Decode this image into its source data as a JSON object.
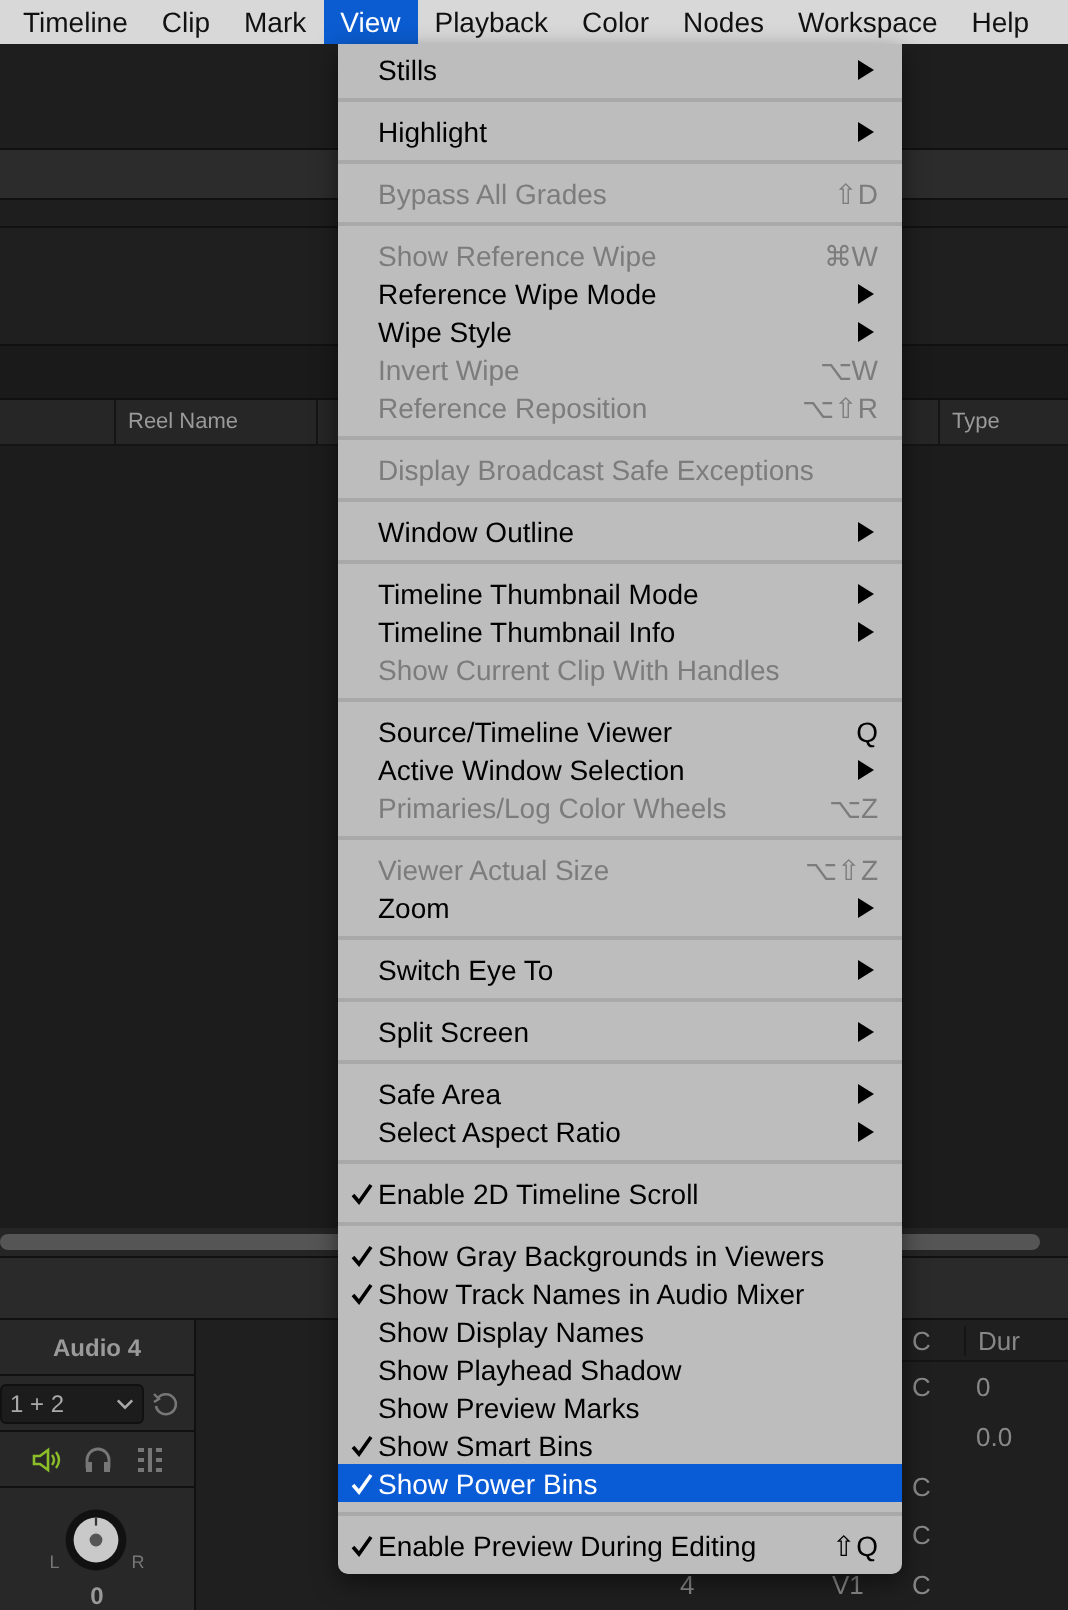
{
  "menu_bar": [
    {
      "label": "Timeline",
      "selected": false
    },
    {
      "label": "Clip",
      "selected": false
    },
    {
      "label": "Mark",
      "selected": false
    },
    {
      "label": "View",
      "selected": true
    },
    {
      "label": "Playback",
      "selected": false
    },
    {
      "label": "Color",
      "selected": false
    },
    {
      "label": "Nodes",
      "selected": false
    },
    {
      "label": "Workspace",
      "selected": false
    },
    {
      "label": "Help",
      "selected": false
    }
  ],
  "view_menu": {
    "groups": [
      [
        {
          "label": "Stills",
          "submenu": true,
          "disabled": false,
          "checked": false,
          "selected": false
        }
      ],
      [
        {
          "label": "Highlight",
          "submenu": true,
          "disabled": false,
          "checked": false,
          "selected": false
        }
      ],
      [
        {
          "label": "Bypass All Grades",
          "shortcut": "⇧D",
          "submenu": false,
          "disabled": true,
          "checked": false,
          "selected": false
        }
      ],
      [
        {
          "label": "Show Reference Wipe",
          "shortcut": "⌘W",
          "submenu": false,
          "disabled": true,
          "checked": false,
          "selected": false
        },
        {
          "label": "Reference Wipe Mode",
          "submenu": true,
          "disabled": false,
          "checked": false,
          "selected": false
        },
        {
          "label": "Wipe Style",
          "submenu": true,
          "disabled": false,
          "checked": false,
          "selected": false
        },
        {
          "label": "Invert Wipe",
          "shortcut": "⌥W",
          "submenu": false,
          "disabled": true,
          "checked": false,
          "selected": false
        },
        {
          "label": "Reference Reposition",
          "shortcut": "⌥⇧R",
          "submenu": false,
          "disabled": true,
          "checked": false,
          "selected": false
        }
      ],
      [
        {
          "label": "Display Broadcast Safe Exceptions",
          "submenu": false,
          "disabled": true,
          "checked": false,
          "selected": false
        }
      ],
      [
        {
          "label": "Window Outline",
          "submenu": true,
          "disabled": false,
          "checked": false,
          "selected": false
        }
      ],
      [
        {
          "label": "Timeline Thumbnail Mode",
          "submenu": true,
          "disabled": false,
          "checked": false,
          "selected": false
        },
        {
          "label": "Timeline Thumbnail Info",
          "submenu": true,
          "disabled": false,
          "checked": false,
          "selected": false
        },
        {
          "label": "Show Current Clip With Handles",
          "submenu": false,
          "disabled": true,
          "checked": false,
          "selected": false
        }
      ],
      [
        {
          "label": "Source/Timeline Viewer",
          "shortcut": "Q",
          "submenu": false,
          "disabled": false,
          "checked": false,
          "selected": false
        },
        {
          "label": "Active Window Selection",
          "submenu": true,
          "disabled": false,
          "checked": false,
          "selected": false
        },
        {
          "label": "Primaries/Log Color Wheels",
          "shortcut": "⌥Z",
          "submenu": false,
          "disabled": true,
          "checked": false,
          "selected": false
        }
      ],
      [
        {
          "label": "Viewer Actual Size",
          "shortcut": "⌥⇧Z",
          "submenu": false,
          "disabled": true,
          "checked": false,
          "selected": false
        },
        {
          "label": "Zoom",
          "submenu": true,
          "disabled": false,
          "checked": false,
          "selected": false
        }
      ],
      [
        {
          "label": "Switch Eye To",
          "submenu": true,
          "disabled": false,
          "checked": false,
          "selected": false
        }
      ],
      [
        {
          "label": "Split Screen",
          "submenu": true,
          "disabled": false,
          "checked": false,
          "selected": false
        }
      ],
      [
        {
          "label": "Safe Area",
          "submenu": true,
          "disabled": false,
          "checked": false,
          "selected": false
        },
        {
          "label": "Select Aspect Ratio",
          "submenu": true,
          "disabled": false,
          "checked": false,
          "selected": false
        }
      ],
      [
        {
          "label": "Enable 2D Timeline Scroll",
          "submenu": false,
          "disabled": false,
          "checked": true,
          "selected": false
        }
      ],
      [
        {
          "label": "Show Gray Backgrounds in Viewers",
          "submenu": false,
          "disabled": false,
          "checked": true,
          "selected": false
        },
        {
          "label": "Show Track Names in Audio Mixer",
          "submenu": false,
          "disabled": false,
          "checked": true,
          "selected": false
        },
        {
          "label": "Show Display Names",
          "submenu": false,
          "disabled": false,
          "checked": false,
          "selected": false
        },
        {
          "label": "Show Playhead Shadow",
          "submenu": false,
          "disabled": false,
          "checked": false,
          "selected": false
        },
        {
          "label": "Show Preview Marks",
          "submenu": false,
          "disabled": false,
          "checked": false,
          "selected": false
        },
        {
          "label": "Show Smart Bins",
          "submenu": false,
          "disabled": false,
          "checked": true,
          "selected": false
        },
        {
          "label": "Show Power Bins",
          "submenu": false,
          "disabled": false,
          "checked": true,
          "selected": true
        }
      ],
      [
        {
          "label": "Enable Preview During Editing",
          "shortcut": "⇧Q",
          "submenu": false,
          "disabled": false,
          "checked": true,
          "selected": false
        }
      ]
    ]
  },
  "clip_list": {
    "columns": [
      "Reel Name",
      "Type"
    ]
  },
  "audio_mixer": {
    "track": "Audio 4",
    "routing": "1 + 2",
    "pan_left": "L",
    "pan_right": "R",
    "pan_value": "0"
  },
  "media_table": {
    "columns": [
      "C",
      "Dur"
    ],
    "rows": [
      {
        "c": "C",
        "dur": "0"
      },
      {
        "dur": "0.0"
      },
      {
        "c": "C"
      },
      {
        "c": "C"
      },
      {
        "column_1": "4",
        "column_2": "V1",
        "c": "C"
      }
    ]
  }
}
